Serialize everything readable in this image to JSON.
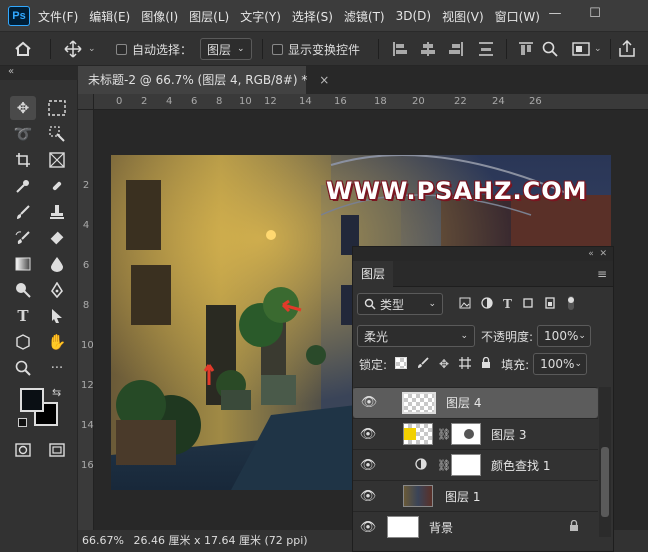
{
  "app": {
    "logo": "Ps"
  },
  "menu": [
    "文件(F)",
    "编辑(E)",
    "图像(I)",
    "图层(L)",
    "文字(Y)",
    "选择(S)",
    "滤镜(T)",
    "3D(D)",
    "视图(V)",
    "窗口(W)"
  ],
  "window_controls": {
    "minimize": "—",
    "maximize": "☐"
  },
  "options": {
    "auto_select_label": "自动选择：",
    "auto_select_target": "图层",
    "show_transform_label": "显示变换控件"
  },
  "document_tab": {
    "title": "未标题-2 @ 66.7% (图层 4, RGB/8#) *",
    "close": "×"
  },
  "ruler_h": [
    "0",
    "2",
    "4",
    "6",
    "8",
    "10",
    "12",
    "14",
    "16",
    "18",
    "20",
    "22",
    "24",
    "26"
  ],
  "ruler_v": [
    "2",
    "4",
    "6",
    "8",
    "10",
    "12",
    "14",
    "16"
  ],
  "canvas": {
    "watermark": "WWW.PSAHZ.COM"
  },
  "status": {
    "zoom": "66.67%",
    "info": "26.46 厘米 x 17.64 厘米 (72 ppi)"
  },
  "layers_panel": {
    "tab": "图层",
    "filter_type": "类型",
    "blend_mode": "柔光",
    "opacity_label": "不透明度:",
    "opacity_value": "100%",
    "lock_label": "锁定:",
    "fill_label": "填充:",
    "fill_value": "100%",
    "layers": [
      {
        "name": "图层 4",
        "selected": true
      },
      {
        "name": "图层 3",
        "selected": false
      },
      {
        "name": "颜色查找 1",
        "selected": false
      },
      {
        "name": "图层 1",
        "selected": false
      },
      {
        "name": "背景",
        "selected": false
      }
    ]
  },
  "colors": {
    "foreground": "#0a0f14",
    "background": "#000000",
    "accent": "#31a8ff",
    "selected_layer": "#5c5c5c"
  }
}
